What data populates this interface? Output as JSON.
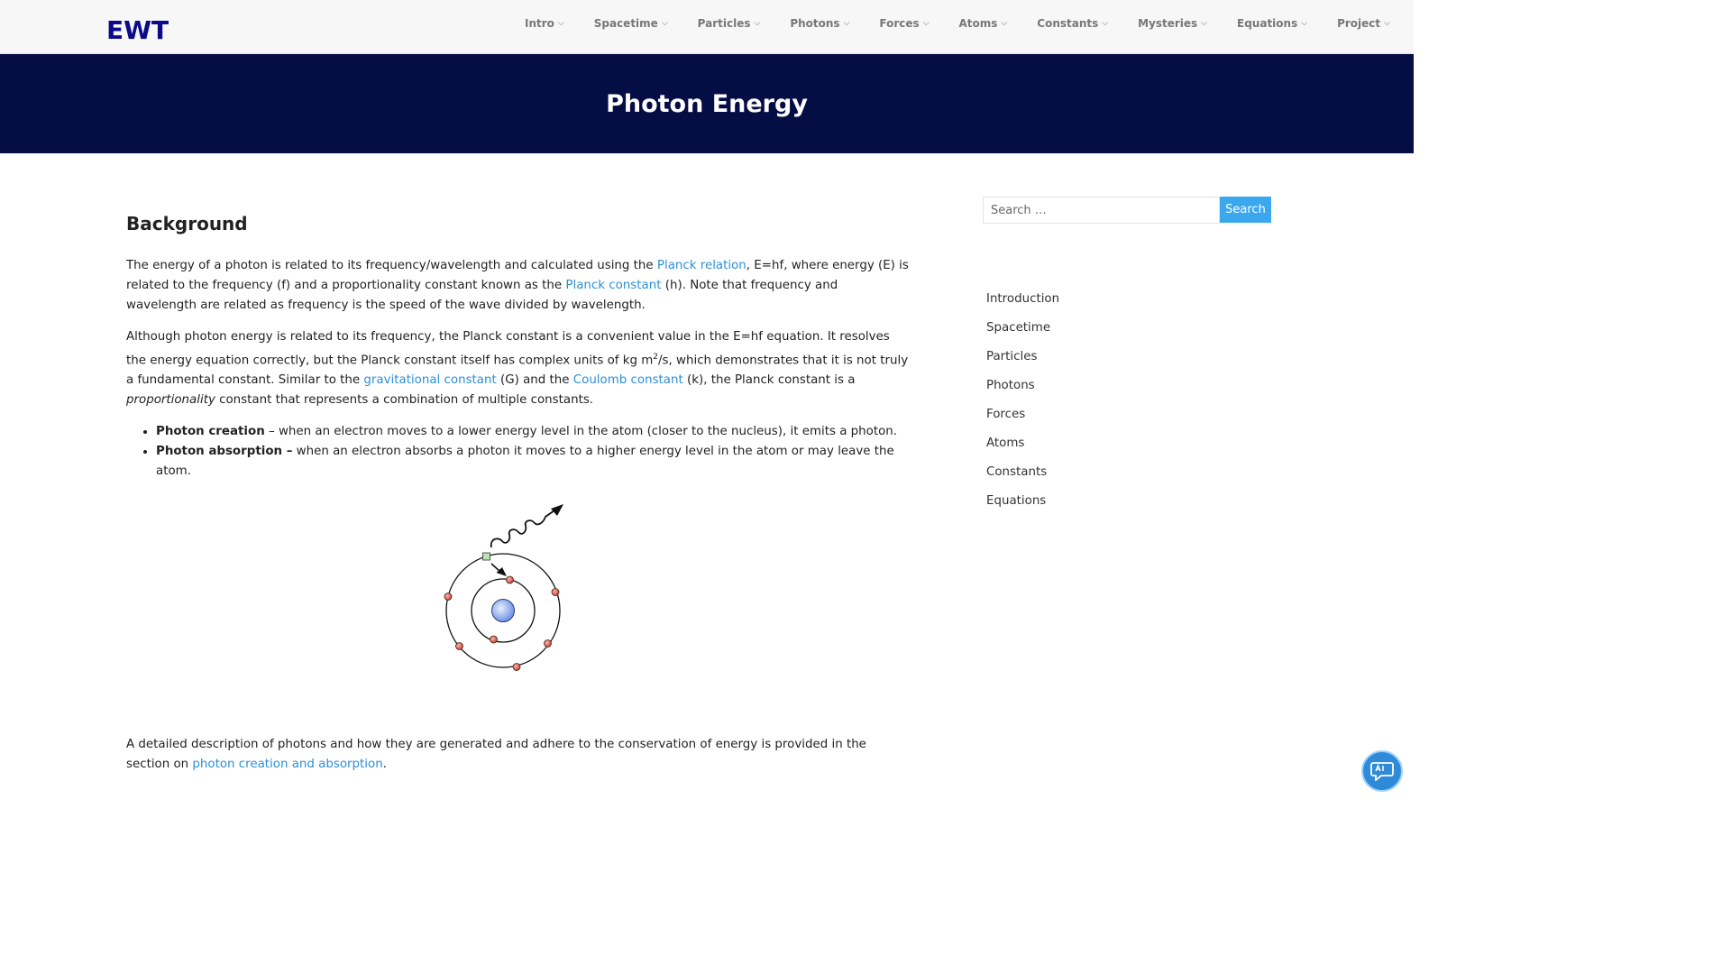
{
  "brand": {
    "logo": "EWT"
  },
  "nav": [
    {
      "label": "Intro"
    },
    {
      "label": "Spacetime"
    },
    {
      "label": "Particles"
    },
    {
      "label": "Photons"
    },
    {
      "label": "Forces"
    },
    {
      "label": "Atoms"
    },
    {
      "label": "Constants"
    },
    {
      "label": "Mysteries"
    },
    {
      "label": "Equations"
    },
    {
      "label": "Project"
    }
  ],
  "hero": {
    "title": "Photon Energy"
  },
  "content": {
    "heading": "Background",
    "p1": {
      "t1": "The energy of a photon is related to its frequency/wavelength and calculated using the ",
      "link1": "Planck relation",
      "t2": ", E=hf, where energy (E) is related to the frequency (f) and a proportionality constant known as the ",
      "link2": "Planck constant",
      "t3": " (h). Note that frequency and wavelength are related as frequency is the speed of the wave divided by wavelength."
    },
    "p2": {
      "t1": "Although photon energy is related to its frequency, the Planck constant is a convenient value in the E=hf equation. It resolves the energy equation correctly, but the Planck constant itself has complex units of kg m",
      "sup": "2",
      "t2": "/s, which demonstrates that it is not truly a fundamental constant. Similar to the ",
      "link1": "gravitational constant",
      "t3": " (G) and the ",
      "link2": "Coulomb constant",
      "t4": " (k), the Planck constant is a ",
      "em": "proportionality",
      "t5": " constant that represents a combination of multiple constants."
    },
    "bullets": [
      {
        "bold": "Photon creation",
        "text": " – when an electron moves to a lower energy level in the atom (closer to the nucleus), it emits a photon."
      },
      {
        "bold": "Photon absorption –",
        "text": " when an electron absorbs a photon it moves to a higher energy level in the atom or may leave the atom."
      }
    ],
    "p3": {
      "t1": "A detailed description of photons and how they are generated and adhere to the conservation of energy is provided in the section on ",
      "link": "photon creation and absorption",
      "t2": "."
    }
  },
  "sidebar": {
    "search_placeholder": "Search …",
    "search_button": "Search",
    "links": [
      "Introduction",
      "Spacetime",
      "Particles",
      "Photons",
      "Forces",
      "Atoms",
      "Constants",
      "Equations"
    ]
  },
  "colors": {
    "hero_bg": "#050d45",
    "logo": "#0b0b8a",
    "link": "#2c8fd6",
    "search_button": "#3aa7ef"
  },
  "icons": {
    "chat": "chat-ai-icon",
    "caret": "chevron-down-icon"
  }
}
